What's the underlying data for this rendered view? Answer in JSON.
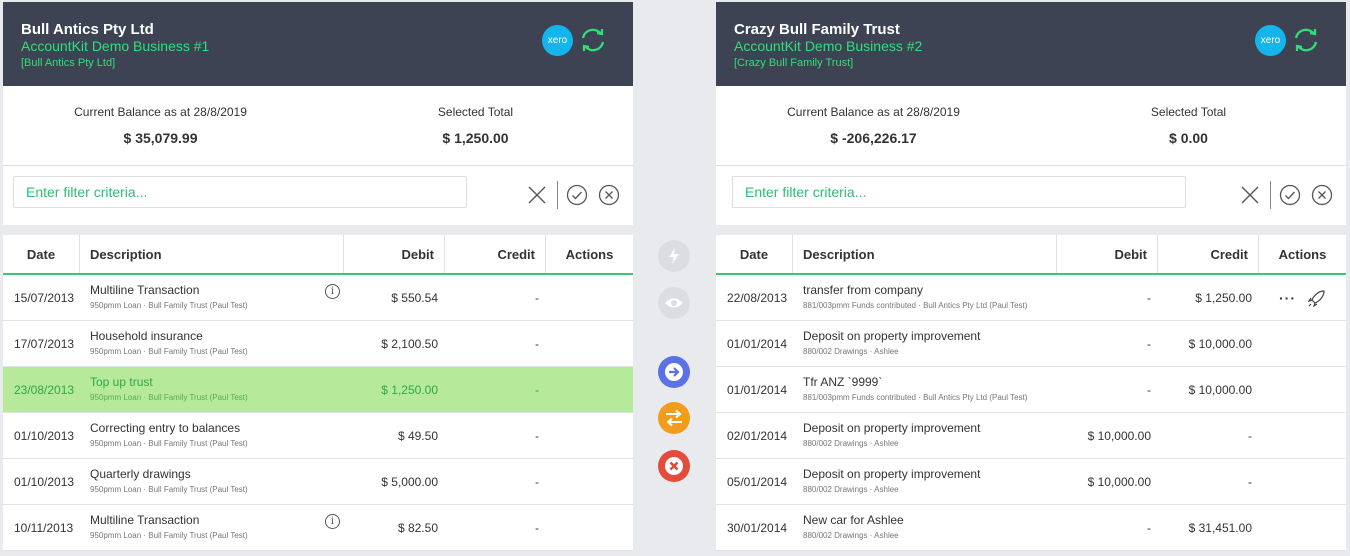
{
  "left": {
    "entity": "Bull Antics Pty Ltd",
    "business": "AccountKit Demo Business #1",
    "sub": "[Bull Antics Pty Ltd]",
    "xero": "xero",
    "balance_label": "Current Balance as at 28/8/2019",
    "balance_value": "$ 35,079.99",
    "selected_label": "Selected Total",
    "selected_value": "$ 1,250.00",
    "filter_placeholder": "Enter filter criteria...",
    "columns": {
      "date": "Date",
      "desc": "Description",
      "debit": "Debit",
      "credit": "Credit",
      "actions": "Actions"
    },
    "rows": [
      {
        "date": "15/07/2013",
        "desc": "Multiline Transaction",
        "sub": "950pmm Loan · Bull Family Trust (Paul Test)",
        "debit": "$ 550.54",
        "credit": "-",
        "info": true,
        "selected": false
      },
      {
        "date": "17/07/2013",
        "desc": "Household insurance",
        "sub": "950pmm Loan · Bull Family Trust (Paul Test)",
        "debit": "$ 2,100.50",
        "credit": "-",
        "info": false,
        "selected": false
      },
      {
        "date": "23/08/2013",
        "desc": "Top up trust",
        "sub": "950pmm Loan · Bull Family Trust (Paul Test)",
        "debit": "$ 1,250.00",
        "credit": "-",
        "info": false,
        "selected": true
      },
      {
        "date": "01/10/2013",
        "desc": "Correcting entry to balances",
        "sub": "950pmm Loan · Bull Family Trust (Paul Test)",
        "debit": "$ 49.50",
        "credit": "-",
        "info": false,
        "selected": false
      },
      {
        "date": "01/10/2013",
        "desc": "Quarterly drawings",
        "sub": "950pmm Loan · Bull Family Trust (Paul Test)",
        "debit": "$ 5,000.00",
        "credit": "-",
        "info": false,
        "selected": false
      },
      {
        "date": "10/11/2013",
        "desc": "Multiline Transaction",
        "sub": "950pmm Loan · Bull Family Trust (Paul Test)",
        "debit": "$ 82.50",
        "credit": "-",
        "info": true,
        "selected": false
      }
    ]
  },
  "right": {
    "entity": "Crazy Bull Family Trust",
    "business": "AccountKit Demo Business #2",
    "sub": "[Crazy Bull Family Trust]",
    "xero": "xero",
    "balance_label": "Current Balance as at 28/8/2019",
    "balance_value": "$ -206,226.17",
    "selected_label": "Selected Total",
    "selected_value": "$ 0.00",
    "filter_placeholder": "Enter filter criteria...",
    "columns": {
      "date": "Date",
      "desc": "Description",
      "debit": "Debit",
      "credit": "Credit",
      "actions": "Actions"
    },
    "rows": [
      {
        "date": "22/08/2013",
        "desc": "transfer from company",
        "sub": "881/003pmm Funds contributed · Bull Antics Pty Ltd (Paul Test)",
        "debit": "-",
        "credit": "$ 1,250.00",
        "actions": true
      },
      {
        "date": "01/01/2014",
        "desc": "Deposit on property improvement",
        "sub": "880/002 Drawings · Ashlee",
        "debit": "-",
        "credit": "$ 10,000.00",
        "actions": false
      },
      {
        "date": "01/01/2014",
        "desc": "Tfr ANZ `9999`",
        "sub": "881/003pmm Funds contributed · Bull Antics Pty Ltd (Paul Test)",
        "debit": "-",
        "credit": "$ 10,000.00",
        "actions": false
      },
      {
        "date": "02/01/2014",
        "desc": "Deposit on property improvement",
        "sub": "880/002 Drawings · Ashlee",
        "debit": "$ 10,000.00",
        "credit": "-",
        "actions": false
      },
      {
        "date": "05/01/2014",
        "desc": "Deposit on property improvement",
        "sub": "880/002 Drawings · Ashlee",
        "debit": "$ 10,000.00",
        "credit": "-",
        "actions": false
      },
      {
        "date": "30/01/2014",
        "desc": "New car for Ashlee",
        "sub": "880/002 Drawings · Ashlee",
        "debit": "-",
        "credit": "$ 31,451.00",
        "actions": false
      }
    ]
  },
  "middle": {
    "buttons": [
      {
        "name": "auto-match-button",
        "icon": "lightning-icon",
        "color": "#dcdde1"
      },
      {
        "name": "preview-button",
        "icon": "eye-icon",
        "color": "#dcdde1"
      },
      {
        "name": "transfer-right-button",
        "icon": "arrow-right-icon",
        "color": "#5a72e6"
      },
      {
        "name": "swap-button",
        "icon": "swap-arrows-icon",
        "color": "#f39c1b"
      },
      {
        "name": "cancel-match-button",
        "icon": "close-icon",
        "color": "#e44b3a"
      }
    ]
  },
  "colors": {
    "header": "#3d4352",
    "accent": "#2ee07b",
    "selected_row": "#b6e99a",
    "xero": "#13b5ea"
  }
}
